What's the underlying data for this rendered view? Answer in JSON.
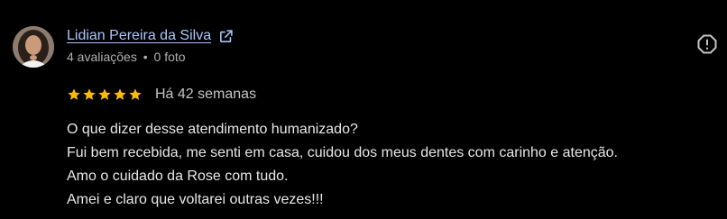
{
  "author": {
    "name": "Lidian Pereira da Silva",
    "reviews_count": "4 avaliações",
    "separator": "•",
    "photos_count": "0 foto",
    "external_link_icon": "external-link-icon",
    "avatar": "profile-photo"
  },
  "review": {
    "rating": 5,
    "max_rating": 5,
    "star_color": "#fbbc04",
    "date": "Há 42 semanas",
    "lines": [
      "O que dizer desse atendimento humanizado?",
      "Fui bem recebida, me senti em casa, cuidou dos meus dentes com carinho e atenção.",
      "Amo o cuidado da Rose com tudo.",
      "Amei e claro que voltarei outras vezes!!!"
    ]
  },
  "actions": {
    "report_icon": "report-icon"
  },
  "colors": {
    "background": "#000000",
    "link": "#a8c7fa",
    "text": "#e8e8e8",
    "meta": "#b0b0b0"
  }
}
